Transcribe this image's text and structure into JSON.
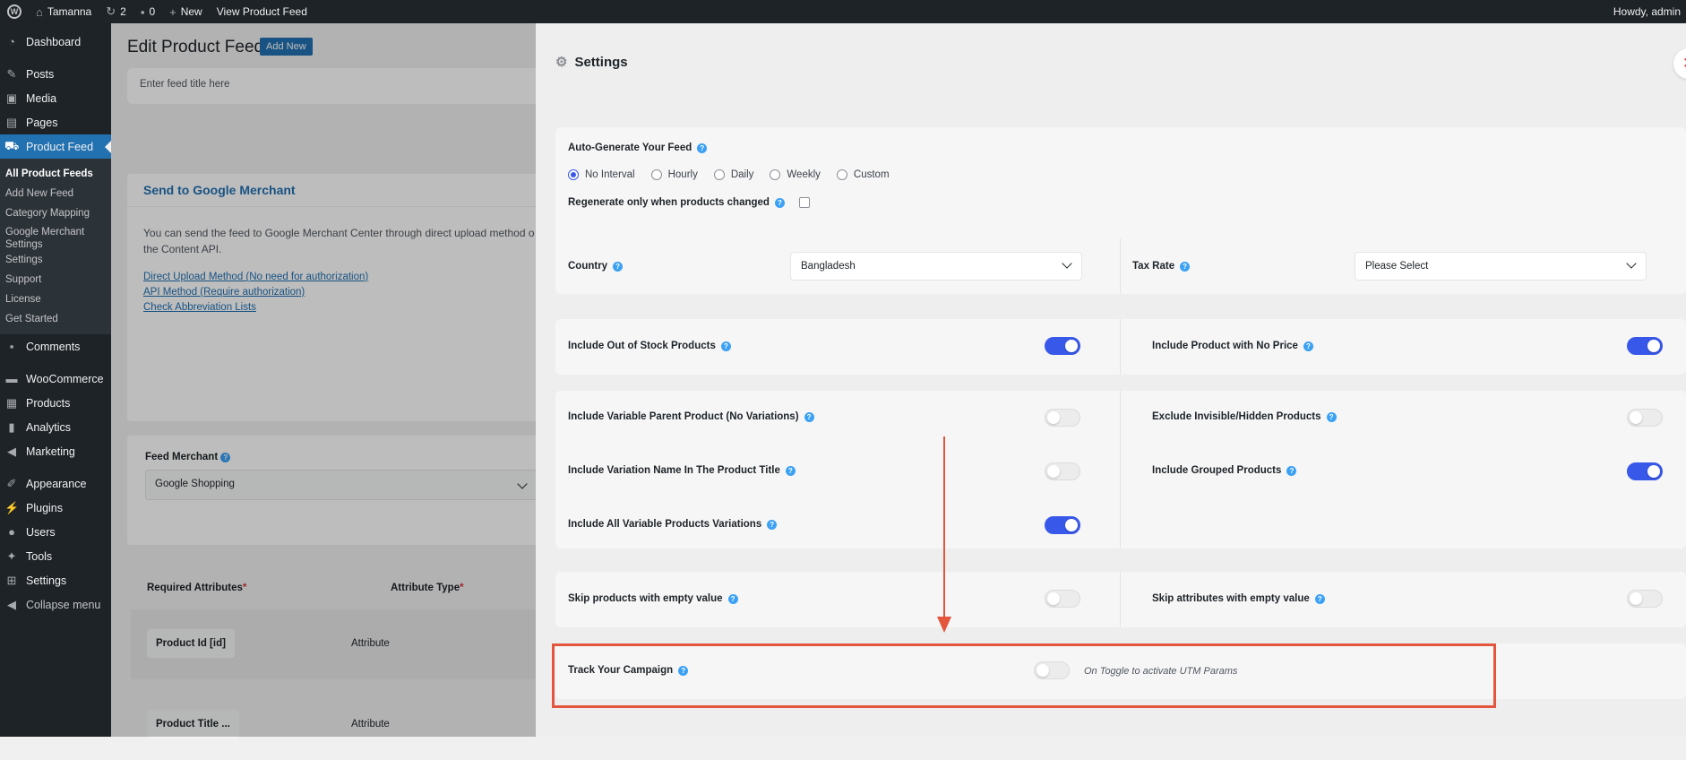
{
  "admin_bar": {
    "site_name": "Tamanna",
    "updates_count": "2",
    "comments_count": "0",
    "new_label": "New",
    "view_label": "View Product Feed",
    "howdy": "Howdy, admin"
  },
  "sidebar": {
    "dashboard": "Dashboard",
    "posts": "Posts",
    "media": "Media",
    "pages": "Pages",
    "product_feed": "Product Feed",
    "sub_items": [
      "All Product Feeds",
      "Add New Feed",
      "Category Mapping",
      "Google Merchant Settings",
      "Settings",
      "Support",
      "License",
      "Get Started"
    ],
    "comments": "Comments",
    "woocommerce": "WooCommerce",
    "products": "Products",
    "analytics": "Analytics",
    "marketing": "Marketing",
    "appearance": "Appearance",
    "plugins": "Plugins",
    "users": "Users",
    "tools": "Tools",
    "settings": "Settings",
    "collapse": "Collapse menu"
  },
  "main": {
    "title": "Edit Product Feed",
    "add_new": "Add New",
    "feed_title_placeholder": "Enter feed title here",
    "google_merchant": {
      "heading": "Send to Google Merchant",
      "text1": "You can send the feed to Google Merchant Center through direct upload method o",
      "text2": "the Content API.",
      "link1": "Direct Upload Method (No need for authorization)",
      "link2": "API Method (Require authorization)",
      "link3": "Check Abbreviation Lists"
    },
    "feed_merchant_label": "Feed Merchant",
    "feed_merchant_value": "Google Shopping",
    "required_attributes": "Required Attributes",
    "attribute_type": "Attribute Type",
    "rows": [
      {
        "name": "Product Id [id]",
        "type": "Attribute"
      },
      {
        "name": "Product Title ...",
        "type": "Attribute"
      }
    ]
  },
  "settings": {
    "title": "Settings",
    "close": "✕",
    "auto_generate_label": "Auto-Generate Your Feed",
    "intervals": [
      "No Interval",
      "Hourly",
      "Daily",
      "Weekly",
      "Custom"
    ],
    "selected_interval": "No Interval",
    "regenerate_label": "Regenerate only when products changed",
    "country_label": "Country",
    "country_value": "Bangladesh",
    "tax_label": "Tax Rate",
    "tax_value": "Please Select",
    "toggles": {
      "out_of_stock": {
        "label": "Include Out of Stock Products",
        "on": true
      },
      "no_price": {
        "label": "Include Product with No Price",
        "on": true
      },
      "variable_parent": {
        "label": "Include Variable Parent Product (No Variations)",
        "on": false
      },
      "exclude_invisible": {
        "label": "Exclude Invisible/Hidden Products",
        "on": false
      },
      "variation_name": {
        "label": "Include Variation Name In The Product Title",
        "on": false
      },
      "grouped": {
        "label": "Include Grouped Products",
        "on": true
      },
      "all_variations": {
        "label": "Include All Variable Products Variations",
        "on": true
      },
      "skip_products": {
        "label": "Skip products with empty value",
        "on": false
      },
      "skip_attributes": {
        "label": "Skip attributes with empty value",
        "on": false
      },
      "track_campaign": {
        "label": "Track Your Campaign",
        "on": false
      }
    },
    "utm_hint": "On Toggle to activate UTM Params"
  },
  "colors": {
    "accent": "#3858e9",
    "wp_blue": "#2271b1",
    "annotation": "#e4553d"
  }
}
